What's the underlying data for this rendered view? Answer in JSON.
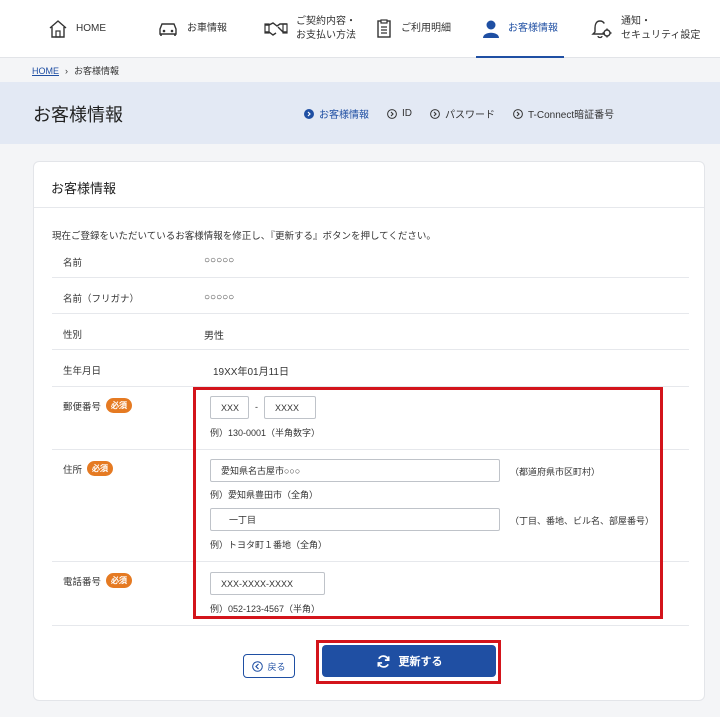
{
  "nav": {
    "home": "HOME",
    "car": "お車情報",
    "contract_line1": "ご契約内容・",
    "contract_line2": "お支払い方法",
    "usage": "ご利用明細",
    "customer": "お客様情報",
    "notify_line1": "通知・",
    "notify_line2": "セキュリティ設定"
  },
  "breadcrumb": {
    "home": "HOME",
    "current": "お客様情報"
  },
  "header": {
    "title": "お客様情報",
    "subnav": [
      "お客様情報",
      "ID",
      "パスワード",
      "T-Connect暗証番号"
    ]
  },
  "card": {
    "title": "お客様情報",
    "intro": "現在ご登録をいただいているお客様情報を修正し、『更新する』ボタンを押してください。",
    "rows": {
      "name_label": "名前",
      "name_value": "○○○○○",
      "kana_label": "名前（フリガナ）",
      "kana_value": "○○○○○",
      "gender_label": "性別",
      "gender_value": "男性",
      "birth_label": "生年月日",
      "birth_value": "19XX年01月11日",
      "postal_label": "郵便番号",
      "address_label": "住所",
      "phone_label": "電話番号"
    },
    "required_badge": "必須",
    "postal": {
      "part1": "XXX",
      "separator": "-",
      "part2": "XXXX",
      "hint": "例）130-0001（半角数字）"
    },
    "address": {
      "line1": "愛知県名古屋市○○○",
      "line1_side": "（都道府県市区町村）",
      "line1_hint": "例）愛知県豊田市（全角）",
      "line2": "一丁目",
      "line2_side": "（丁目、番地、ビル名、部屋番号）",
      "line2_hint": "例）トヨタ町１番地（全角）"
    },
    "phone": {
      "value": "XXX-XXXX-XXXX",
      "hint": "例）052-123-4567（半角）"
    }
  },
  "buttons": {
    "back": "戻る",
    "update": "更新する"
  },
  "colors": {
    "accent": "#1f4fa3",
    "required": "#e57a22",
    "highlight": "#d3141b"
  }
}
